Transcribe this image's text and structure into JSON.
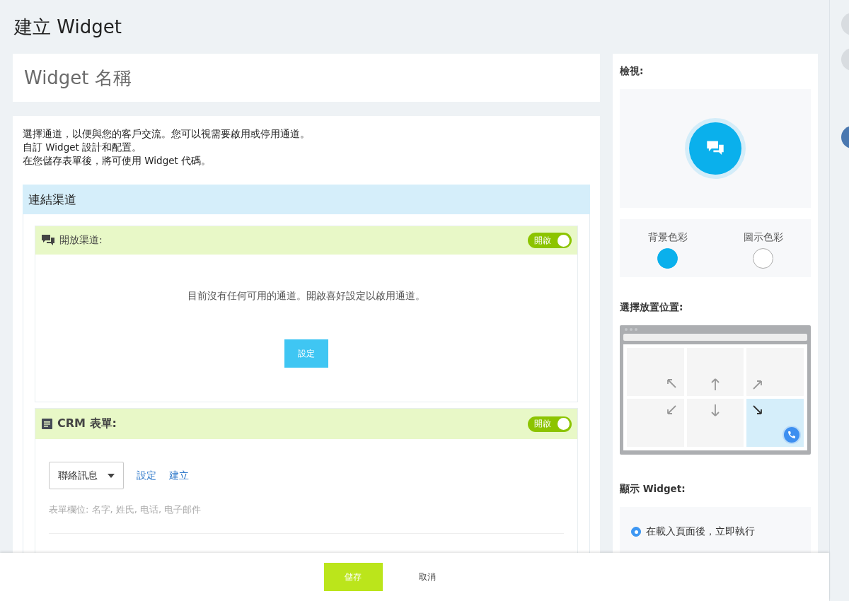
{
  "page_title": "建立 Widget",
  "name_field": {
    "placeholder": "Widget 名稱"
  },
  "intro": [
    "選擇通道，以便與您的客戶交流。您可以視需要啟用或停用通道。",
    "自訂 Widget 設計和配置。",
    "在您儲存表單後，將可使用 Widget 代碼。"
  ],
  "connect_section": {
    "title": "連結渠道"
  },
  "open_channels": {
    "title": "開放渠道:",
    "toggle": {
      "label": "開啟",
      "on": true
    },
    "empty_message": "目前沒有任何可用的通道。開啟喜好設定以啟用通道。",
    "button": "設定"
  },
  "crm_form": {
    "title": "CRM 表單:",
    "toggle": {
      "label": "開啟",
      "on": true
    },
    "select": "聯絡訊息",
    "links": [
      "設定",
      "建立"
    ],
    "fields_note": "表單欄位: 名字, 姓氏, 电话, 电子邮件"
  },
  "preview": {
    "title": "檢視:",
    "colors": [
      {
        "label": "背景色彩",
        "color": "#0ab0ec"
      },
      {
        "label": "圖示色彩",
        "color": "#ffffff"
      }
    ]
  },
  "placement": {
    "title": "選擇放置位置:",
    "positions": [
      {
        "selected": false
      },
      {
        "selected": false
      },
      {
        "selected": false
      },
      {
        "selected": false
      },
      {
        "selected": false
      },
      {
        "selected": true
      }
    ]
  },
  "display": {
    "title": "顯示 Widget:",
    "options": [
      {
        "label": "在載入頁面後，立即執行",
        "selected": true
      }
    ]
  },
  "footer": {
    "buttons": [
      {
        "label": "儲存",
        "kind": "primary"
      },
      {
        "label": "取消",
        "kind": "plain"
      }
    ]
  }
}
